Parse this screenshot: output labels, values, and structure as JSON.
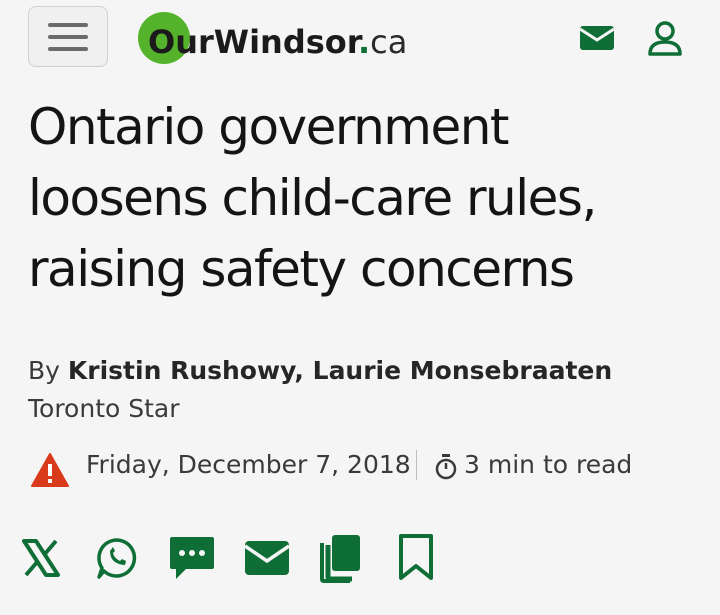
{
  "header": {
    "menu_icon": "hamburger-icon",
    "logo": {
      "brand": "OurWindsor",
      "dot": ".",
      "tld": "ca"
    },
    "icons": [
      "envelope-icon",
      "user-icon"
    ]
  },
  "article": {
    "headline": "Ontario government loosens child-care rules, raising safety concerns",
    "byline_prefix": "By ",
    "authors": "Kristin Rushowy, Laurie Monsebraaten",
    "source": " Toronto Star",
    "date": "Friday, December 7, 2018",
    "read_time": "3 min to read"
  },
  "share_icons": [
    "x-icon",
    "whatsapp-icon",
    "sms-icon",
    "email-icon",
    "copy-icon",
    "bookmark-icon"
  ],
  "colors": {
    "brand_green": "#0f6e36",
    "logo_circle": "#55b22b",
    "alert_red": "#d93a1c"
  }
}
